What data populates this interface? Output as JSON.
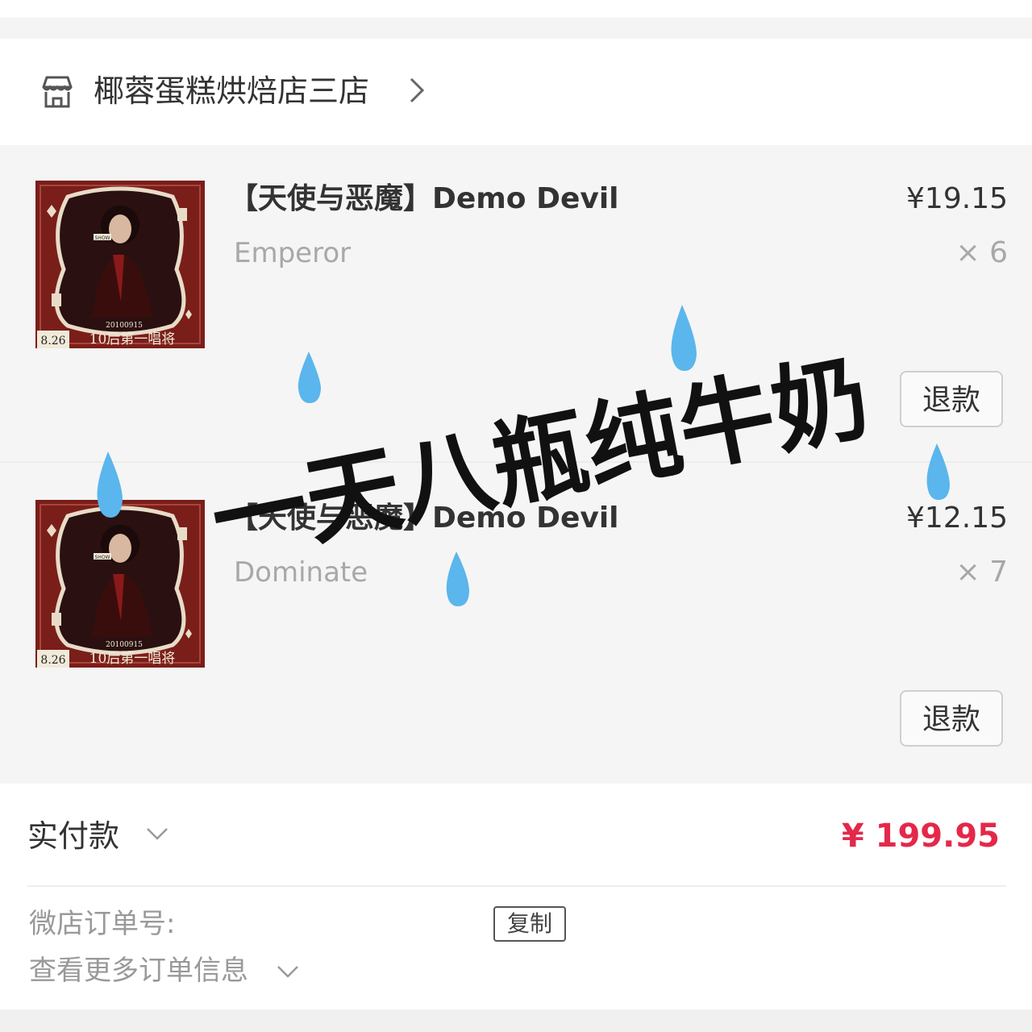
{
  "shop": {
    "name": "椰蓉蛋糕烘焙店三店",
    "icon": "store-icon",
    "chevron_icon": "chevron-right-icon"
  },
  "items": [
    {
      "title": "【天使与恶魔】Demo Devil",
      "variant": "Emperor",
      "price": "¥19.15",
      "qty": "× 6",
      "refund_label": "退款",
      "thumb": {
        "date_badge": "8.26",
        "date_line": "20100915",
        "caption": "10后第一唱将",
        "logo": "SHOW"
      }
    },
    {
      "title": "【天使与恶魔】Demo Devil",
      "variant": "Dominate",
      "price": "¥12.15",
      "qty": "× 7",
      "refund_label": "退款",
      "thumb": {
        "date_badge": "8.26",
        "date_line": "20100915",
        "caption": "10后第一唱将",
        "logo": "SHOW"
      }
    }
  ],
  "summary": {
    "pay_label": "实付款",
    "pay_amount": "¥ 199.95",
    "order_label": "微店订单号:",
    "copy_label": "复制",
    "more_label": "查看更多订单信息"
  },
  "overlay": {
    "handwritten_text": "一天八瓶纯牛奶",
    "drop_icon": "water-drop-icon"
  },
  "colors": {
    "accent_price": "#e4284a",
    "drop": "#5ab6ec",
    "thumb_bg": "#7a1e1a"
  }
}
